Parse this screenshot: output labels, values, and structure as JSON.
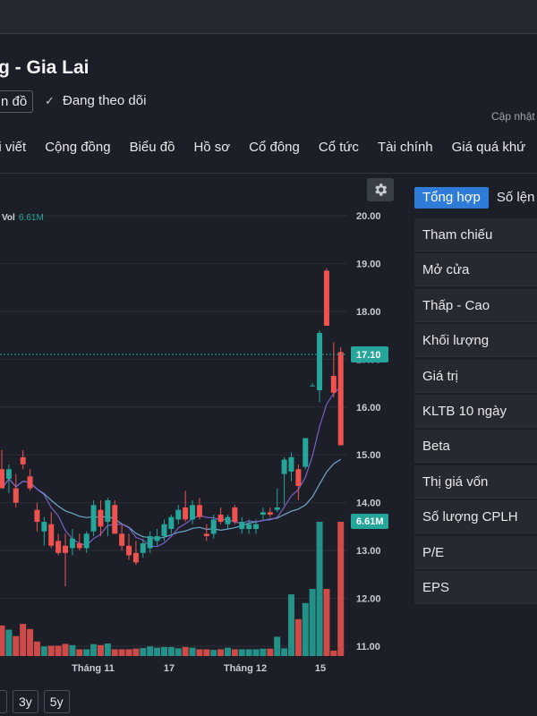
{
  "header": {
    "title": "g - Gia Lai",
    "chart_button": "n đồ",
    "follow_label": "Đang theo dõi",
    "updated_label": "Cập nhật"
  },
  "nav": {
    "items": [
      "ài viết",
      "Cộng đồng",
      "Biểu đồ",
      "Hồ sơ",
      "Cổ đông",
      "Cổ tức",
      "Tài chính",
      "Giá quá khứ"
    ]
  },
  "chart_data": {
    "type": "candlestick",
    "ylim": [
      10.85,
      20.2
    ],
    "y_ticks": [
      "20.00",
      "19.00",
      "18.00",
      "17.00",
      "16.00",
      "15.00",
      "14.00",
      "13.00",
      "12.00",
      "11.00"
    ],
    "x_ticks": [
      "Tháng 11",
      "17",
      "Tháng 12",
      "15"
    ],
    "last_price_label": "17.10",
    "volume_label_prefix": "Vol",
    "volume_label": "6.61M",
    "volume_value_tag": "6.61M",
    "colors": {
      "up": "#26a69a",
      "down": "#ef5350",
      "ma_slow": "#6fa8c9",
      "ma_fast": "#7b5fc8",
      "grid": "#2b2e36",
      "axis_text": "#c8cbd1"
    },
    "candles": [
      {
        "o": 14.7,
        "h": 15.1,
        "l": 14.3,
        "c": 14.3
      },
      {
        "o": 14.5,
        "h": 14.8,
        "l": 14.2,
        "c": 14.7
      },
      {
        "o": 14.3,
        "h": 14.6,
        "l": 13.9,
        "c": 14.0
      },
      {
        "o": 14.95,
        "h": 15.1,
        "l": 14.7,
        "c": 14.8
      },
      {
        "o": 14.55,
        "h": 14.7,
        "l": 14.25,
        "c": 14.3
      },
      {
        "o": 13.85,
        "h": 14.0,
        "l": 13.4,
        "c": 13.6
      },
      {
        "o": 13.4,
        "h": 13.7,
        "l": 13.1,
        "c": 13.6
      },
      {
        "o": 13.55,
        "h": 13.8,
        "l": 13.05,
        "c": 13.1
      },
      {
        "o": 13.2,
        "h": 13.35,
        "l": 12.9,
        "c": 12.95
      },
      {
        "o": 13.1,
        "h": 13.35,
        "l": 12.25,
        "c": 12.95
      },
      {
        "o": 13.05,
        "h": 13.45,
        "l": 12.9,
        "c": 13.25
      },
      {
        "o": 13.15,
        "h": 13.35,
        "l": 13.0,
        "c": 13.05
      },
      {
        "o": 13.05,
        "h": 13.4,
        "l": 12.95,
        "c": 13.35
      },
      {
        "o": 13.4,
        "h": 14.05,
        "l": 13.3,
        "c": 13.95
      },
      {
        "o": 13.85,
        "h": 14.05,
        "l": 13.3,
        "c": 13.5
      },
      {
        "o": 13.6,
        "h": 14.1,
        "l": 13.3,
        "c": 14.05
      },
      {
        "o": 13.95,
        "h": 14.05,
        "l": 13.35,
        "c": 13.35
      },
      {
        "o": 13.35,
        "h": 13.55,
        "l": 13.0,
        "c": 13.1
      },
      {
        "o": 13.1,
        "h": 13.35,
        "l": 12.8,
        "c": 12.9
      },
      {
        "o": 12.95,
        "h": 13.2,
        "l": 12.7,
        "c": 12.75
      },
      {
        "o": 12.95,
        "h": 13.25,
        "l": 12.85,
        "c": 13.15
      },
      {
        "o": 13.05,
        "h": 13.4,
        "l": 12.95,
        "c": 13.3
      },
      {
        "o": 13.2,
        "h": 13.45,
        "l": 13.1,
        "c": 13.3
      },
      {
        "o": 13.3,
        "h": 13.65,
        "l": 13.2,
        "c": 13.55
      },
      {
        "o": 13.45,
        "h": 13.75,
        "l": 13.35,
        "c": 13.7
      },
      {
        "o": 13.65,
        "h": 13.95,
        "l": 13.55,
        "c": 13.85
      },
      {
        "o": 13.9,
        "h": 14.25,
        "l": 13.6,
        "c": 13.65
      },
      {
        "o": 13.65,
        "h": 14.05,
        "l": 13.55,
        "c": 13.95
      },
      {
        "o": 13.95,
        "h": 14.1,
        "l": 13.65,
        "c": 13.7
      },
      {
        "o": 13.35,
        "h": 13.55,
        "l": 13.2,
        "c": 13.3
      },
      {
        "o": 13.35,
        "h": 13.75,
        "l": 13.25,
        "c": 13.65
      },
      {
        "o": 13.75,
        "h": 13.9,
        "l": 13.55,
        "c": 13.6
      },
      {
        "o": 13.55,
        "h": 13.75,
        "l": 13.45,
        "c": 13.7
      },
      {
        "o": 13.9,
        "h": 13.95,
        "l": 13.55,
        "c": 13.6
      },
      {
        "o": 13.45,
        "h": 13.7,
        "l": 13.35,
        "c": 13.6
      },
      {
        "o": 13.45,
        "h": 13.65,
        "l": 13.35,
        "c": 13.55
      },
      {
        "o": 13.45,
        "h": 13.65,
        "l": 13.35,
        "c": 13.55
      },
      {
        "o": 13.75,
        "h": 13.9,
        "l": 13.65,
        "c": 13.8
      },
      {
        "o": 13.8,
        "h": 13.9,
        "l": 13.7,
        "c": 13.75
      },
      {
        "o": 13.85,
        "h": 14.3,
        "l": 13.8,
        "c": 13.9
      },
      {
        "o": 14.6,
        "h": 14.95,
        "l": 13.95,
        "c": 14.9
      },
      {
        "o": 14.65,
        "h": 15.05,
        "l": 14.45,
        "c": 14.95
      },
      {
        "o": 14.7,
        "h": 14.8,
        "l": 14.05,
        "c": 14.35
      },
      {
        "o": 14.75,
        "h": 15.35,
        "l": 14.7,
        "c": 15.35
      },
      {
        "o": 16.45,
        "h": 16.5,
        "l": 16.45,
        "c": 16.45
      },
      {
        "o": 16.35,
        "h": 17.6,
        "l": 16.1,
        "c": 17.55
      },
      {
        "o": 18.85,
        "h": 18.9,
        "l": 17.7,
        "c": 17.7
      },
      {
        "o": 16.65,
        "h": 17.35,
        "l": 16.2,
        "c": 16.3
      },
      {
        "o": 17.15,
        "h": 17.25,
        "l": 15.2,
        "c": 15.2
      }
    ],
    "volumes": [
      0.95,
      0.82,
      0.62,
      1.0,
      0.84,
      0.45,
      0.3,
      0.32,
      0.32,
      0.38,
      0.34,
      0.21,
      0.21,
      0.37,
      0.34,
      0.39,
      0.21,
      0.21,
      0.21,
      0.23,
      0.25,
      0.3,
      0.26,
      0.28,
      0.28,
      0.24,
      0.28,
      0.26,
      0.21,
      0.21,
      0.19,
      0.21,
      0.26,
      0.21,
      0.21,
      0.21,
      0.21,
      0.23,
      0.23,
      0.6,
      0.24,
      1.92,
      1.15,
      1.65,
      2.09,
      4.18,
      2.09,
      0.17,
      4.18
    ]
  },
  "side_panel": {
    "tabs": [
      "Tổng hợp",
      "Số lện"
    ],
    "stats": [
      "Tham chiếu",
      "Mở cửa",
      "Thấp - Cao",
      "Khối lượng",
      "Giá trị",
      "KLTB 10 ngày",
      "Beta",
      "Thị giá vốn",
      "Số lượng CPLH",
      "P/E",
      "EPS"
    ]
  },
  "range_buttons": [
    "",
    "3y",
    "5y"
  ]
}
